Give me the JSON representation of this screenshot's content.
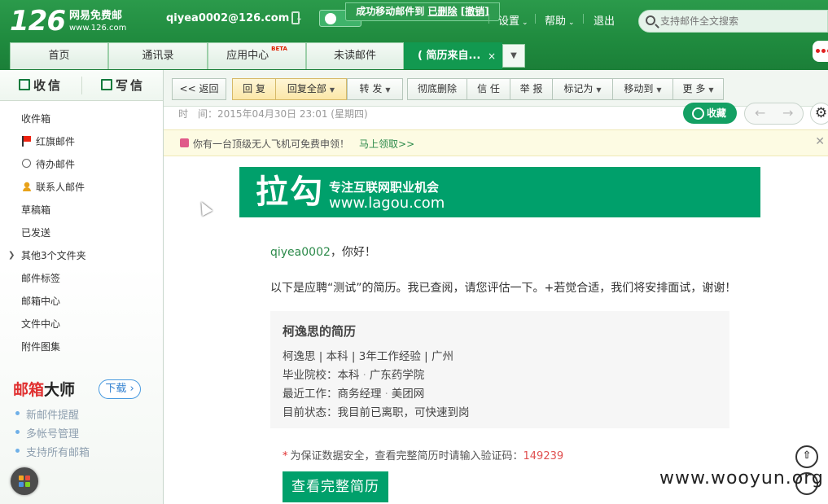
{
  "header": {
    "logo_num": "126",
    "logo_cn": "网易免费邮",
    "logo_url": "www.126.com",
    "account": "qiyea0002@126.com",
    "app_label": "应用",
    "toast_text": "成功移动邮件到",
    "toast_folder": "已删除",
    "toast_undo": "[撤销]",
    "nav": {
      "settings": "设置",
      "help": "帮助",
      "logout": "退出"
    },
    "search_placeholder": "支持邮件全文搜索"
  },
  "tabs": [
    {
      "label": "首页"
    },
    {
      "label": "通讯录"
    },
    {
      "label": "应用中心",
      "badge": "BETA"
    },
    {
      "label": "未读邮件"
    },
    {
      "label": "( 简历来自...",
      "close": "×"
    }
  ],
  "sidebar": {
    "receive": "收信",
    "compose": "写信",
    "folders": [
      "收件箱",
      "红旗邮件",
      "待办邮件",
      "联系人邮件",
      "草稿箱",
      "已发送",
      "其他3个文件夹",
      "邮件标签",
      "邮箱中心",
      "文件中心",
      "附件图集"
    ],
    "master": {
      "title_red": "邮箱",
      "title_dark": "大师",
      "download": "下载",
      "items": [
        "新邮件提醒",
        "多帐号管理",
        "支持所有邮箱"
      ]
    }
  },
  "toolbar": {
    "back": "<< 返回",
    "reply": "回 复",
    "reply_all": "回复全部",
    "forward": "转 发",
    "delete": "彻底删除",
    "trust": "信 任",
    "report": "举 报",
    "mark": "标记为",
    "move": "移动到",
    "more": "更 多"
  },
  "mail": {
    "time_label": "时　间：",
    "time_value": "2015年04月30日 23:01 (星期四)",
    "favorite": "收藏",
    "ad_text": "你有一台顶级无人飞机可免费申领！",
    "ad_link": "马上领取>>",
    "banner_big": "拉勾",
    "banner_slogan": "专注互联网职业机会",
    "banner_url": "www.lagou.com",
    "greet_name": "qiyea0002",
    "greet_rest": "，你好！",
    "intro": "以下是应聘“测试”的简历。我已查阅，请您评估一下。+若觉合适，我们将安排面试，谢谢！",
    "card": {
      "title": "柯逸思的简历",
      "line1": "柯逸思 | 本科 | 3年工作经验 | 广州",
      "school_label": "毕业院校：本科",
      "school": "广东药学院",
      "work_label": "最近工作：商务经理",
      "work": "美团网",
      "status": "目前状态：我目前已离职，可快速到岗"
    },
    "verify_text": "为保证数据安全，查看完整简历时请输入验证码：",
    "verify_code": "149239",
    "view_full": "查看完整简历"
  },
  "watermark": "www.wooyun.org",
  "colors": {
    "brand_green": "#1f8a3e",
    "lagou_green": "#00a06b",
    "alert_red": "#e03030"
  }
}
